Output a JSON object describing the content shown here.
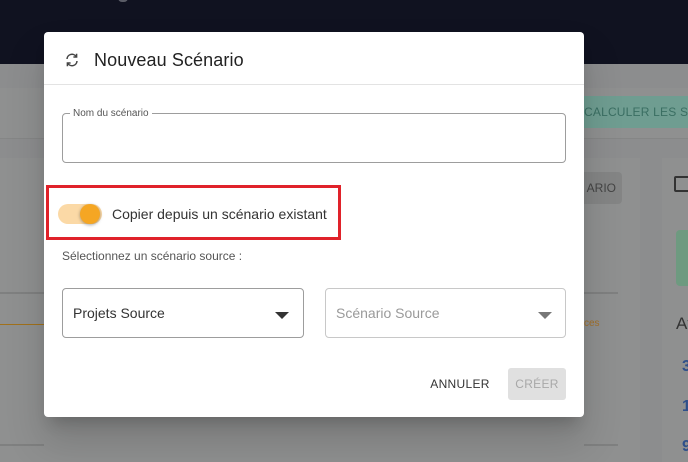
{
  "background": {
    "recalc_button": "CALCULER LES SCÉ",
    "scenario_chip": "ARIO",
    "ces_text": "ces",
    "at_text": "At",
    "numbers": [
      "3",
      "1",
      "9"
    ]
  },
  "dialog": {
    "title": "Nouveau Scénario",
    "title_icon": "refresh-icon",
    "name_field": {
      "label": "Nom du scénario",
      "value": ""
    },
    "copy_toggle": {
      "label": "Copier depuis un scénario existant",
      "checked": true
    },
    "source_prompt": "Sélectionnez un scénario source :",
    "project_select": {
      "value": "Projets Source"
    },
    "scenario_select": {
      "value": "Scénario Source"
    },
    "buttons": {
      "cancel": "ANNULER",
      "create": "CRÉER"
    }
  },
  "colors": {
    "accent": "#f5a623",
    "highlight": "#e0222a",
    "overlay": "#8c8d8e"
  }
}
